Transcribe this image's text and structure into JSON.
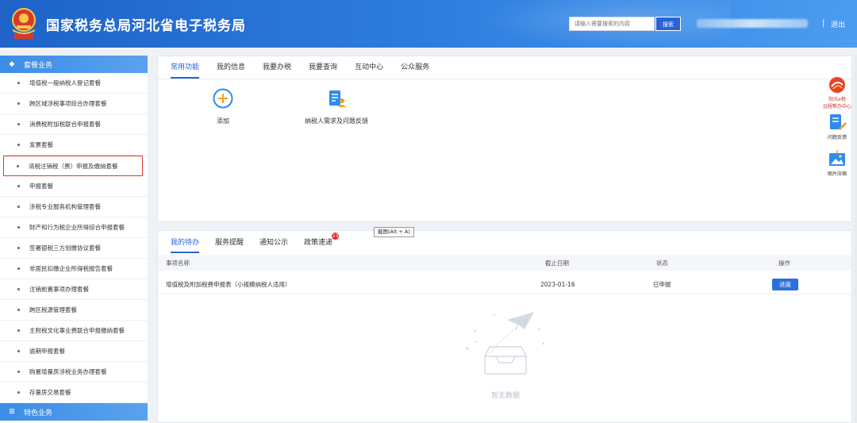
{
  "header": {
    "site_title": "国家税务总局河北省电子税务局",
    "search_placeholder": "请输入需要搜索的内容",
    "search_button": "搜索",
    "separator": "|",
    "logout": "退出"
  },
  "sidebar": {
    "category_1": "套餐业务",
    "items": [
      {
        "label": "增值税一般纳税人登记套餐"
      },
      {
        "label": "跨区域涉税事项综合办理套餐"
      },
      {
        "label": "消费税附加税联合申报套餐"
      },
      {
        "label": "发票套餐"
      },
      {
        "label": "清税注销税（费）申报及缴纳套餐"
      },
      {
        "label": "申报套餐"
      },
      {
        "label": "涉税专业服务机构管理套餐"
      },
      {
        "label": "财产和行为税企业所得综合申报套餐"
      },
      {
        "label": "签署银税三方划缴协议套餐"
      },
      {
        "label": "非居民扣缴企业所得税报告套餐"
      },
      {
        "label": "注销前置事项办理套餐"
      },
      {
        "label": "跨区税源管理套餐"
      },
      {
        "label": "主附税文化事业费联合申报缴纳套餐"
      },
      {
        "label": "逾期申报套餐"
      },
      {
        "label": "购置增量房涉税业务办理套餐"
      },
      {
        "label": "存量房交易套餐"
      }
    ],
    "category_2": "特色业务"
  },
  "top_tabs": [
    "常用功能",
    "我的信息",
    "我要办税",
    "我要查询",
    "互动中心",
    "公众服务"
  ],
  "functions": {
    "add": "添加",
    "feedback": "纳税人需求及问题反馈"
  },
  "bottom_tabs": [
    "我的待办",
    "服务提醒",
    "通知公示",
    "政策速递"
  ],
  "badge_count": "23",
  "tooltip": "截图(Alt + A)",
  "table": {
    "headers": {
      "name": "事项名称",
      "deadline": "截止日期",
      "status": "状态",
      "action": "操作"
    },
    "rows": [
      {
        "name": "增值税及附加税费申报表（小规模纳税人适用）",
        "deadline": "2023-01-16",
        "status": "已申报",
        "action": "进度"
      }
    ]
  },
  "empty_text": "暂无数据",
  "right_tools": {
    "help_line1": "阳光e税",
    "help_line2": "远程帮办中心",
    "feedback": "问题反馈",
    "compress": "图片压缩"
  },
  "colors": {
    "primary": "#2764d8",
    "header_start": "#1f63c8",
    "header_end": "#4c9cf0",
    "sidebar_category": "#3c8de6",
    "highlight_border": "#d9342b",
    "badge": "#e0262c"
  }
}
